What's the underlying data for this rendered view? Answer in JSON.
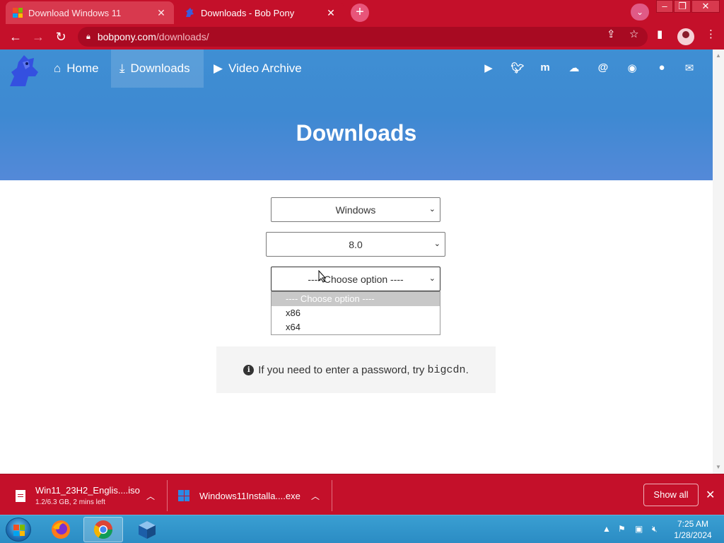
{
  "browser": {
    "tabs": [
      {
        "title": "Download Windows 11",
        "favicon": "microsoft-logo-icon",
        "active": false
      },
      {
        "title": "Downloads - Bob Pony",
        "favicon": "bobpony-logo-icon",
        "active": true
      }
    ],
    "new_tab_label": "+",
    "address": {
      "host": "bobpony.com",
      "path": "/downloads/"
    },
    "colors": {
      "frame": "#c4102a",
      "omnibox": "#a80a22"
    }
  },
  "site": {
    "nav": [
      {
        "label": "Home",
        "icon": "home-icon",
        "active": false
      },
      {
        "label": "Downloads",
        "icon": "download-icon",
        "active": true
      },
      {
        "label": "Video Archive",
        "icon": "video-camera-icon",
        "active": false
      }
    ],
    "social_icons": [
      "youtube-icon",
      "twitter-icon",
      "mastodon-icon",
      "cloud-icon",
      "threads-icon",
      "discord-icon",
      "github-icon",
      "mail-icon"
    ],
    "hero_title": "Downloads",
    "colors": {
      "hero": "#3f8fd3"
    }
  },
  "form": {
    "os_select": {
      "value": "Windows"
    },
    "version_select": {
      "value": "8.0"
    },
    "arch_select": {
      "value": "---- Choose option ----",
      "options": [
        "---- Choose option ----",
        "x86",
        "x64"
      ],
      "open": true
    }
  },
  "info": {
    "text": "If you need to enter a password, try ",
    "code": "bigcdn",
    "suffix": "."
  },
  "downloads": {
    "items": [
      {
        "name": "Win11_23H2_Englis....iso",
        "status": "1.2/6.3 GB, 2 mins left",
        "icon": "file-icon"
      },
      {
        "name": "Windows11Installa....exe",
        "status": "",
        "icon": "windows-installer-icon"
      }
    ],
    "show_all_label": "Show all"
  },
  "taskbar": {
    "apps": [
      "firefox-icon",
      "chrome-icon",
      "virtualbox-icon"
    ],
    "time": "7:25 AM",
    "date": "1/28/2024"
  }
}
